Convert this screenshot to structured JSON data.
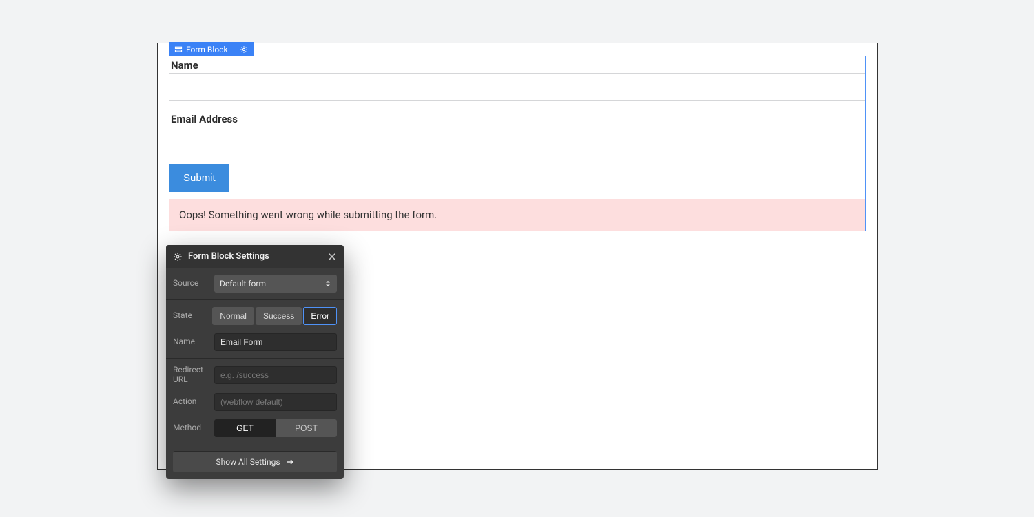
{
  "block_tag": {
    "label": "Form Block"
  },
  "form": {
    "name_label": "Name",
    "email_label": "Email Address",
    "submit_label": "Submit",
    "error_message": "Oops! Something went wrong while submitting the form."
  },
  "settings": {
    "title": "Form Block Settings",
    "source_label": "Source",
    "source_value": "Default form",
    "state_label": "State",
    "state_options": {
      "normal": "Normal",
      "success": "Success",
      "error": "Error"
    },
    "name_label": "Name",
    "name_value": "Email Form",
    "redirect_label": "Redirect URL",
    "redirect_placeholder": "e.g. /success",
    "action_label": "Action",
    "action_placeholder": "(webflow default)",
    "method_label": "Method",
    "method_get": "GET",
    "method_post": "POST",
    "show_all": "Show All Settings"
  }
}
